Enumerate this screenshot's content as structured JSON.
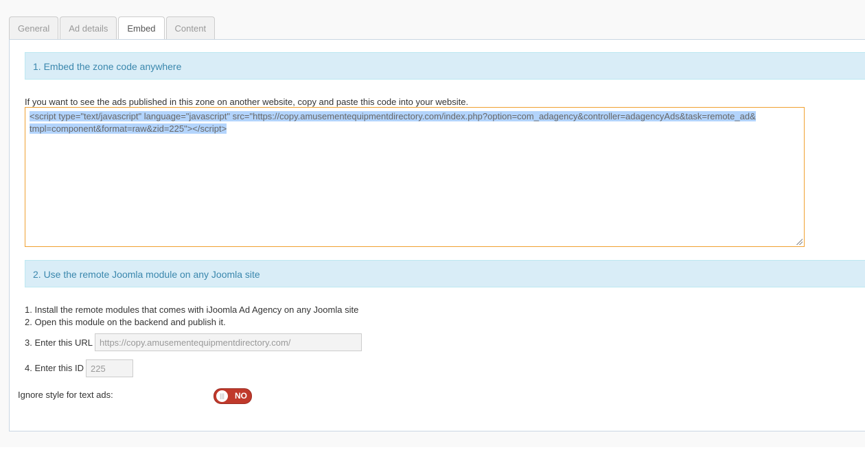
{
  "tabs": [
    "General",
    "Ad details",
    "Embed",
    "Content"
  ],
  "section1": {
    "title": "1. Embed the zone code anywhere",
    "description": "If you want to see the ads published in this zone on another website, copy and paste this code into your website.",
    "code_line1": "<script type=\"text/javascript\" language=\"javascript\" src=\"https://copy.amusementequipmentdirectory.com/index.php?option=com_adagency&controller=adagencyAds&task=remote_ad&",
    "code_line2": "tmpl=component&format=raw&zid=225\"></script>"
  },
  "section2": {
    "title": "2. Use the remote Joomla module on any Joomla site",
    "step1": "1. Install the remote modules that comes with iJoomla Ad Agency on any Joomla site",
    "step2": "2. Open this module on the backend and publish it.",
    "step3_label": "3. Enter this URL",
    "url_value": "https://copy.amusementequipmentdirectory.com/",
    "step4_label": "4. Enter this ID",
    "id_value": "225"
  },
  "ignore_style": {
    "label": "Ignore style for text ads:",
    "toggle_label": "NO",
    "knob": "|||"
  },
  "colors": {
    "toggle": "#c0392b",
    "section_bg": "#d9edf7",
    "section_text": "#3a87ad"
  }
}
